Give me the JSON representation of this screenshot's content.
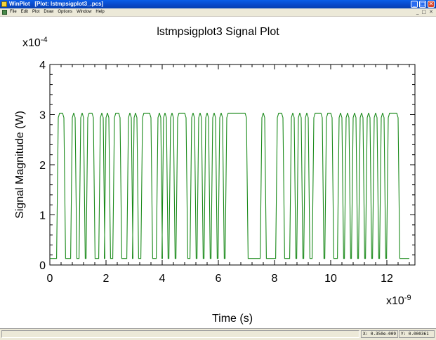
{
  "window": {
    "title": "WinPlot   [Plot: lstmpsigplot3_.pcs]",
    "min_glyph": "_",
    "max_glyph": "□",
    "close_glyph": "✕"
  },
  "menu": {
    "items": [
      "File",
      "Edit",
      "Plot",
      "Draw",
      "Options",
      "Window",
      "Help"
    ],
    "mdi_min": "_",
    "mdi_max": "□",
    "mdi_close": "✕"
  },
  "status": {
    "x_readout": "X: 0.350e-009",
    "y_readout": "Y: 0.000361"
  },
  "colors": {
    "signal": "#1a8a1a",
    "axes": "#000000"
  },
  "chart_data": {
    "type": "line",
    "title": "lstmpsigplot3  Signal Plot",
    "xlabel": "Time (s)",
    "ylabel": "Signal Magnitude (W)",
    "x_multiplier": "x10",
    "x_exponent": "-9",
    "y_multiplier": "x10",
    "y_exponent": "-4",
    "xlim": [
      0,
      13.0
    ],
    "ylim": [
      0,
      4
    ],
    "xticks": [
      0,
      2,
      4,
      6,
      8,
      10,
      12
    ],
    "yticks": [
      0,
      1,
      2,
      3,
      4
    ],
    "high_level": 3.03,
    "low_level": 0.13,
    "high_intervals": [
      [
        0.3,
        0.5
      ],
      [
        0.8,
        0.9
      ],
      [
        1.1,
        1.2
      ],
      [
        1.35,
        1.55
      ],
      [
        1.8,
        1.9
      ],
      [
        2.0,
        2.1
      ],
      [
        2.3,
        2.5
      ],
      [
        2.8,
        2.9
      ],
      [
        3.0,
        3.1
      ],
      [
        3.3,
        3.6
      ],
      [
        3.85,
        3.95
      ],
      [
        4.05,
        4.15
      ],
      [
        4.3,
        4.4
      ],
      [
        4.55,
        4.85
      ],
      [
        5.05,
        5.15
      ],
      [
        5.3,
        5.4
      ],
      [
        5.55,
        5.65
      ],
      [
        5.8,
        5.9
      ],
      [
        6.05,
        6.15
      ],
      [
        6.3,
        7.0
      ],
      [
        7.55,
        7.65
      ],
      [
        8.1,
        8.3
      ],
      [
        8.6,
        8.7
      ],
      [
        8.85,
        8.95
      ],
      [
        9.1,
        9.2
      ],
      [
        9.4,
        9.7
      ],
      [
        9.85,
        10.05
      ],
      [
        10.3,
        10.4
      ],
      [
        10.55,
        10.65
      ],
      [
        10.8,
        10.9
      ],
      [
        11.05,
        11.15
      ],
      [
        11.3,
        11.4
      ],
      [
        11.55,
        11.65
      ],
      [
        11.8,
        11.9
      ],
      [
        12.05,
        12.4
      ]
    ],
    "x_end": 12.8
  }
}
